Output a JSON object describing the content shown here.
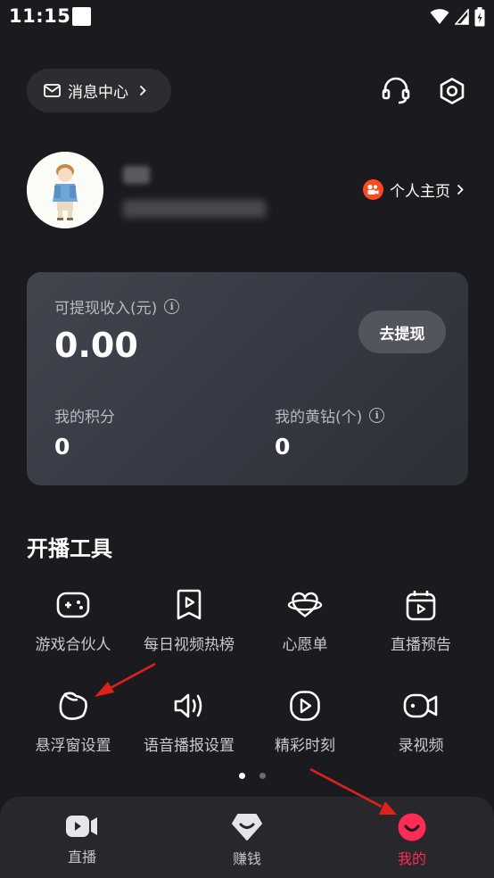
{
  "status_bar": {
    "time": "11:15"
  },
  "header": {
    "message_center_label": "消息中心"
  },
  "profile": {
    "homepage_label": "个人主页"
  },
  "earnings": {
    "withdrawable_label": "可提现收入(元)",
    "withdrawable_value": "0.00",
    "withdraw_button": "去提现",
    "points_label": "我的积分",
    "points_value": "0",
    "diamonds_label": "我的黄钻(个)",
    "diamonds_value": "0"
  },
  "tools": {
    "title": "开播工具",
    "items": [
      {
        "label": "游戏合伙人",
        "icon": "gamepad-icon"
      },
      {
        "label": "每日视频热榜",
        "icon": "bookmark-play-icon"
      },
      {
        "label": "心愿单",
        "icon": "heart-planet-icon"
      },
      {
        "label": "直播预告",
        "icon": "calendar-play-icon"
      },
      {
        "label": "悬浮窗设置",
        "icon": "floating-window-icon"
      },
      {
        "label": "语音播报设置",
        "icon": "speaker-icon"
      },
      {
        "label": "精彩时刻",
        "icon": "play-circle-icon"
      },
      {
        "label": "录视频",
        "icon": "camera-record-icon"
      }
    ]
  },
  "tab_bar": {
    "items": [
      {
        "label": "直播",
        "icon": "video-camera-icon",
        "active": false
      },
      {
        "label": "赚钱",
        "icon": "money-gem-icon",
        "active": false
      },
      {
        "label": "我的",
        "icon": "smile-face-icon",
        "active": true
      }
    ]
  },
  "colors": {
    "background": "#1b1b1f",
    "accent": "#fe2c55",
    "arrow": "#e0201c",
    "kuaishou": "#fe4a1e"
  }
}
